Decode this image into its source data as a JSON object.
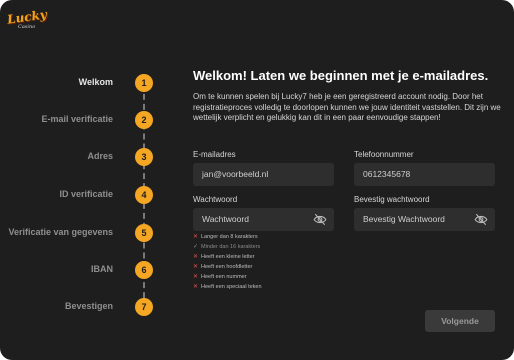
{
  "logo": {
    "title": "Lucky",
    "subtitle": "Casino"
  },
  "steps": [
    {
      "number": "1",
      "label": "Welkom",
      "active": true
    },
    {
      "number": "2",
      "label": "E-mail verificatie"
    },
    {
      "number": "3",
      "label": "Adres"
    },
    {
      "number": "4",
      "label": "ID verificatie"
    },
    {
      "number": "5",
      "label": "Verificatie van gegevens"
    },
    {
      "number": "6",
      "label": "IBAN"
    },
    {
      "number": "7",
      "label": "Bevestigen"
    }
  ],
  "heading": "Welkom! Laten we beginnen met je e-mailadres.",
  "intro": "Om te kunnen spelen bij Lucky7 heb je een geregistreerd account nodig. Door het registratieproces volledig te doorlopen kunnen we jouw identiteit vaststellen. Dit zijn we wettelijk verplicht en gelukkig kan dit in een paar eenvoudige stappen!",
  "form": {
    "email": {
      "label": "E-mailadres",
      "value": "jan@voorbeeld.nl"
    },
    "phone": {
      "label": "Telefoonnummer",
      "value": "0612345678"
    },
    "password": {
      "label": "Wachtwoord",
      "placeholder": "Wachtwoord"
    },
    "confirm": {
      "label": "Bevestig wachtwoord",
      "placeholder": "Bevestig Wachtwoord"
    }
  },
  "rules": [
    {
      "text": "Langer dan 8 karakters",
      "status": "fail",
      "mark": "✕"
    },
    {
      "text": "Minder dan 16 karakters",
      "status": "ok",
      "mark": "✓"
    },
    {
      "text": "Heeft een kleine letter",
      "status": "fail",
      "mark": "✕"
    },
    {
      "text": "Heeft een hoofdletter",
      "status": "fail",
      "mark": "✕"
    },
    {
      "text": "Heeft een nummer",
      "status": "fail",
      "mark": "✕"
    },
    {
      "text": "Heeft een speciaal teken",
      "status": "fail",
      "mark": "✕"
    }
  ],
  "next_label": "Volgende",
  "colors": {
    "accent": "#f5a623",
    "background": "#1e1e1e",
    "input": "#2e2e2e",
    "error": "#e05050"
  },
  "icons": {
    "password_toggle": "eye-off-icon"
  }
}
